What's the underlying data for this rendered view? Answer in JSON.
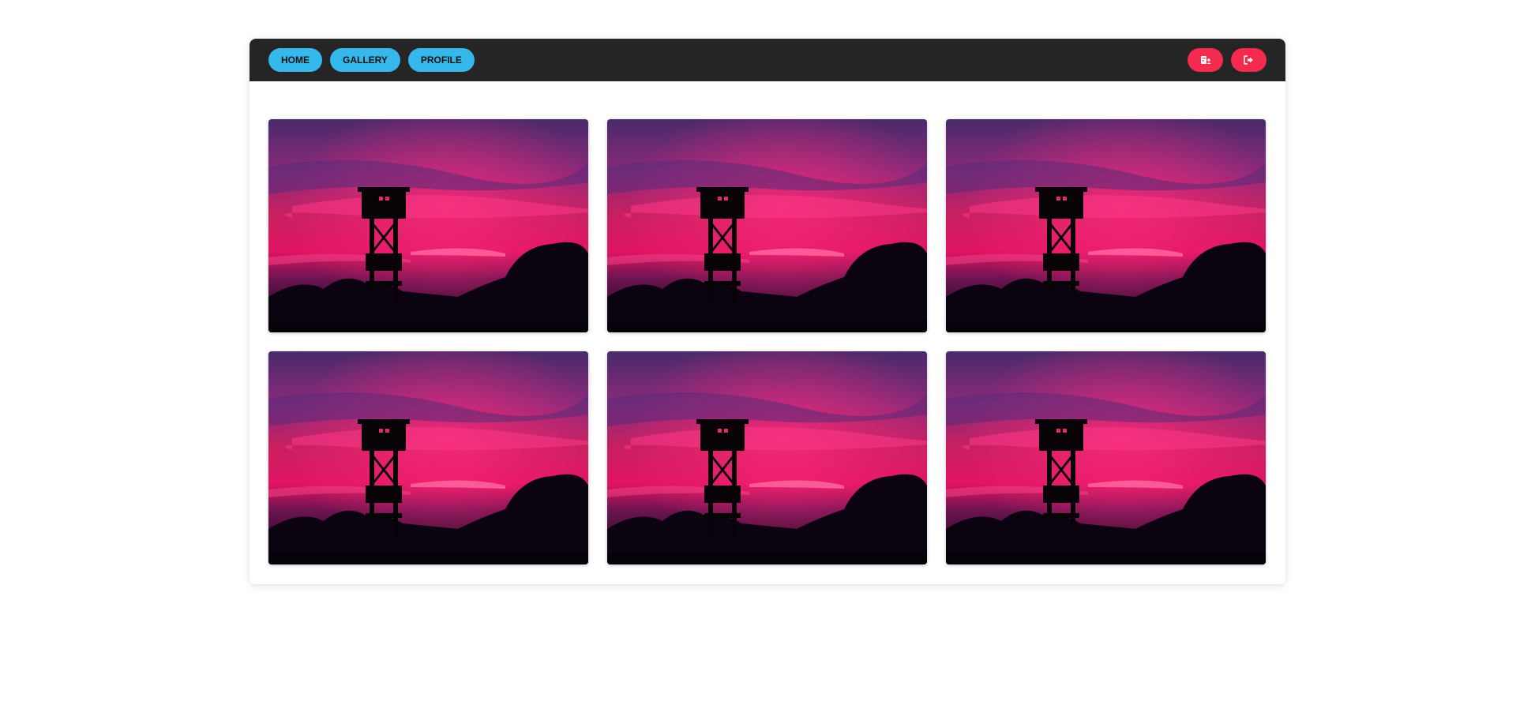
{
  "nav": {
    "items": [
      {
        "label": "HOME"
      },
      {
        "label": "GALLERY"
      },
      {
        "label": "PROFILE"
      }
    ],
    "actions": [
      {
        "icon": "hospital-user-icon"
      },
      {
        "icon": "logout-icon"
      }
    ]
  },
  "gallery": {
    "images": [
      {
        "subject": "watchtower-sunset-photo"
      },
      {
        "subject": "watchtower-sunset-photo"
      },
      {
        "subject": "watchtower-sunset-photo"
      },
      {
        "subject": "watchtower-sunset-photo"
      },
      {
        "subject": "watchtower-sunset-photo"
      },
      {
        "subject": "watchtower-sunset-photo"
      }
    ]
  },
  "colors": {
    "navbar": "#252525",
    "nav_button": "#35b8ec",
    "action_button": "#f42a4f"
  }
}
